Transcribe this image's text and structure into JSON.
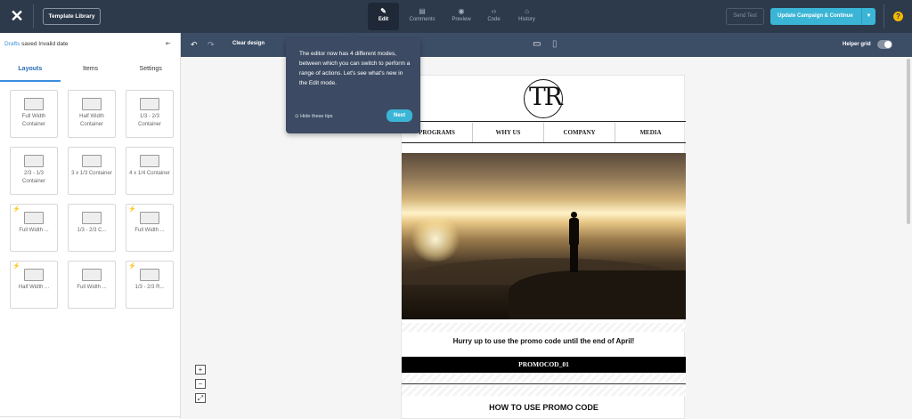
{
  "topbar": {
    "close_icon": "close-icon",
    "template_library": "Template Library",
    "modes": [
      {
        "label": "Edit",
        "icon": "✎",
        "icon_name": "pencil-icon",
        "active": true
      },
      {
        "label": "Comments",
        "icon": "▤",
        "icon_name": "comment-icon",
        "active": false
      },
      {
        "label": "Preview",
        "icon": "◉",
        "icon_name": "eye-icon",
        "active": false
      },
      {
        "label": "Code",
        "icon": "‹›",
        "icon_name": "code-icon",
        "active": false
      },
      {
        "label": "History",
        "icon": "⌂",
        "icon_name": "history-icon",
        "active": false
      }
    ],
    "send_test": "Send Test",
    "update": "Update Campaign & Continue",
    "update_caret": "▼",
    "help": "?",
    "accent": "#3bb5d6"
  },
  "left": {
    "status_drafts": "Drafts",
    "status_rest": " saved Invalid date",
    "collapse": "⇤",
    "tabs": [
      "Layouts",
      "Items",
      "Settings"
    ],
    "blocks": [
      {
        "label": "Full Width Container",
        "pro": false
      },
      {
        "label": "Half Width Container",
        "pro": false
      },
      {
        "label": "1/3 - 2/3 Container",
        "pro": false
      },
      {
        "label": "2/3 - 1/3 Container",
        "pro": false
      },
      {
        "label": "3 x 1/3 Container",
        "pro": false
      },
      {
        "label": "4 x 1/4 Container",
        "pro": false
      },
      {
        "label": "Full Width ...",
        "pro": true
      },
      {
        "label": "1/3 - 2/3 C...",
        "pro": true
      },
      {
        "label": "Full Width ...",
        "pro": true
      },
      {
        "label": "Half Width ...",
        "pro": true
      },
      {
        "label": "Full Width ...",
        "pro": true
      },
      {
        "label": "1/3 - 2/3 R...",
        "pro": true
      }
    ]
  },
  "editor": {
    "undo": "↶",
    "redo": "↷",
    "clear": "Clear design",
    "desktop": "▭",
    "mobile": "▯",
    "helper_grid": "Helper grid"
  },
  "email": {
    "logo": "TR",
    "nav": [
      "PROGRAMS",
      "WHY US",
      "COMPANY",
      "MEDIA"
    ],
    "promo_text": "Hurry up to use the promo code until the end of April!",
    "promo_code": "PROMOCOD_01",
    "how_title": "HOW TO USE PROMO CODE"
  },
  "zoom": {
    "in": "+",
    "out": "−",
    "fit": "⤢"
  },
  "tooltip": {
    "text": "The editor now has 4 different modes, between which you can switch to perform a range of actions. Let's see what's new in the Edit mode.",
    "hide": "⊙ Hide these tips",
    "next": "Next"
  }
}
